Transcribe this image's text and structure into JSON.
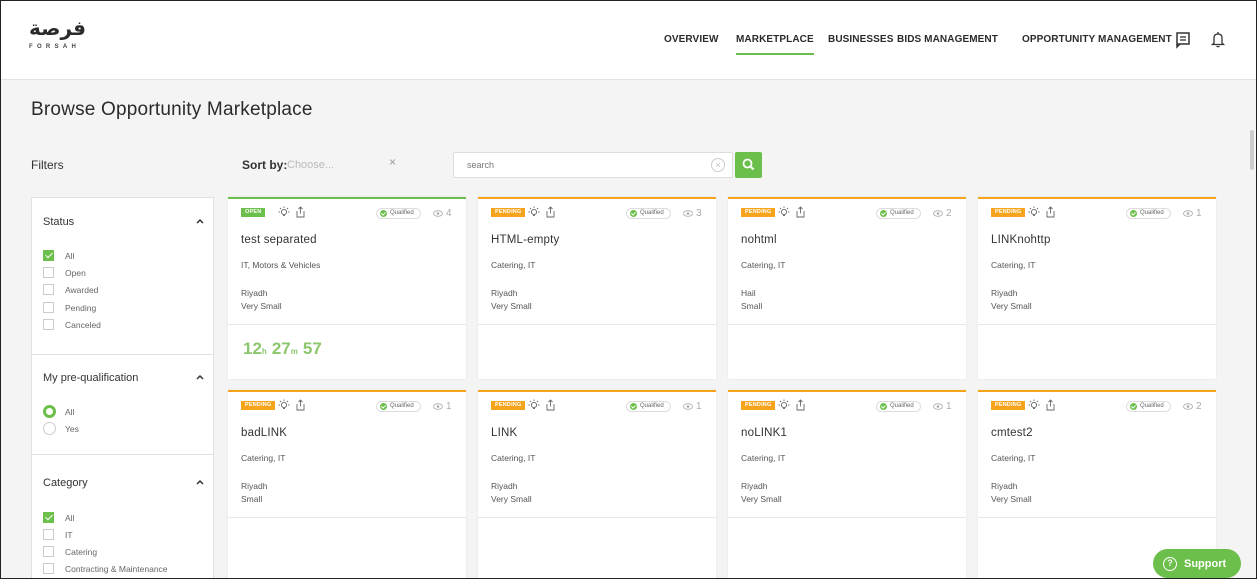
{
  "brand": {
    "name_ar": "فرصة",
    "name_en": "FORSAH"
  },
  "nav": {
    "items": [
      {
        "label": "OVERVIEW",
        "active": false
      },
      {
        "label": "MARKETPLACE",
        "active": true
      },
      {
        "label": "BUSINESSES",
        "active": false
      },
      {
        "label": "BIDS MANAGEMENT",
        "active": false
      },
      {
        "label": "OPPORTUNITY MANAGEMENT",
        "active": false
      }
    ],
    "icons": [
      "messages-icon",
      "notifications-bell-icon"
    ]
  },
  "page": {
    "title": "Browse Opportunity Marketplace"
  },
  "toolbar": {
    "filters_label": "Filters",
    "sort_label": "Sort by:",
    "sort_placeholder": "Choose...",
    "sort_clear": "×",
    "search_placeholder": "search"
  },
  "filters": {
    "status": {
      "title": "Status",
      "options": [
        {
          "label": "All",
          "checked": true
        },
        {
          "label": "Open",
          "checked": false
        },
        {
          "label": "Awarded",
          "checked": false
        },
        {
          "label": "Pending",
          "checked": false
        },
        {
          "label": "Canceled",
          "checked": false
        }
      ]
    },
    "prequal": {
      "title": "My pre-qualification",
      "options": [
        {
          "label": "All",
          "checked": true
        },
        {
          "label": "Yes",
          "checked": false
        }
      ]
    },
    "category": {
      "title": "Category",
      "options": [
        {
          "label": "All",
          "checked": true
        },
        {
          "label": "IT",
          "checked": false
        },
        {
          "label": "Catering",
          "checked": false
        },
        {
          "label": "Contracting & Maintenance",
          "checked": false
        }
      ]
    }
  },
  "cards": [
    {
      "status": "OPEN",
      "qualified": "Qualified",
      "views": "4",
      "title": "test separated",
      "categories": "IT, Motors & Vehicles",
      "city": "Riyadh",
      "size": "Very Small",
      "countdown": {
        "h": "12",
        "h_unit": "h",
        "m": "27",
        "m_unit": "m",
        "s": "57"
      }
    },
    {
      "status": "PENDING",
      "qualified": "Qualified",
      "views": "3",
      "title": "HTML-empty",
      "categories": "Catering, IT",
      "city": "Riyadh",
      "size": "Very Small"
    },
    {
      "status": "PENDING",
      "qualified": "Qualified",
      "views": "2",
      "title": "nohtml",
      "categories": "Catering, IT",
      "city": "Hail",
      "size": "Small"
    },
    {
      "status": "PENDING",
      "qualified": "Qualified",
      "views": "1",
      "title": "LINKnohttp",
      "categories": "Catering, IT",
      "city": "Riyadh",
      "size": "Very Small"
    },
    {
      "status": "PENDING",
      "qualified": "Qualified",
      "views": "1",
      "title": "badLINK",
      "categories": "Catering, IT",
      "city": "Riyadh",
      "size": "Small"
    },
    {
      "status": "PENDING",
      "qualified": "Qualified",
      "views": "1",
      "title": "LINK",
      "categories": "Catering, IT",
      "city": "Riyadh",
      "size": "Very Small"
    },
    {
      "status": "PENDING",
      "qualified": "Qualified",
      "views": "1",
      "title": "noLINK1",
      "categories": "Catering, IT",
      "city": "Riyadh",
      "size": "Very Small"
    },
    {
      "status": "PENDING",
      "qualified": "Qualified",
      "views": "2",
      "title": "cmtest2",
      "categories": "Catering, IT",
      "city": "Riyadh",
      "size": "Very Small"
    }
  ],
  "support": {
    "label": "Support",
    "icon": "?"
  },
  "colors": {
    "accent": "#6cbf4a",
    "pending": "#f7a41d",
    "countdown": "#8cc66d"
  }
}
